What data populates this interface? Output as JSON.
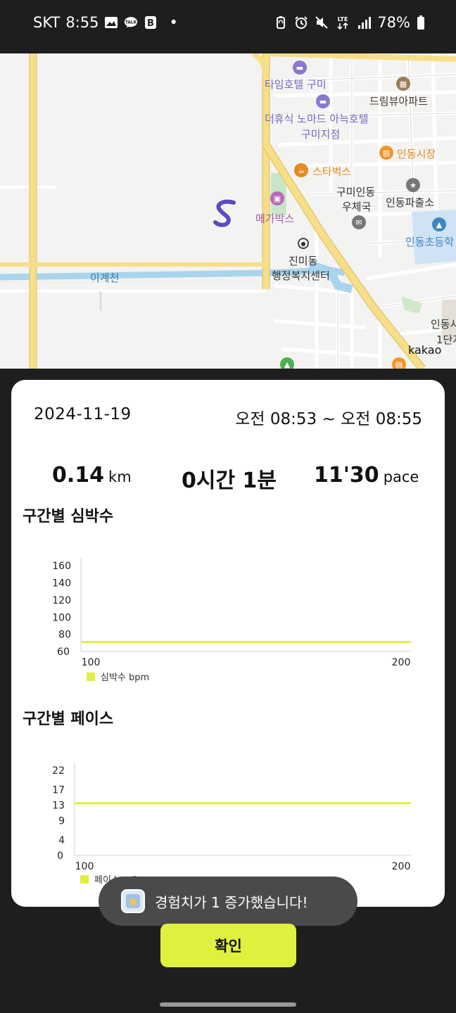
{
  "status_bar": {
    "carrier": "SKT",
    "time": "8:55",
    "dot": "•",
    "talk_badge": "TALK",
    "b_badge": "B",
    "network": "LTE",
    "battery": "78%"
  },
  "map": {
    "labels": {
      "time_hotel": "타임호텔 구미",
      "dream_view": "드림뷰아파트",
      "nomad_hotel_1": "더휴식 노마드 아늑호텔",
      "nomad_hotel_2": "구미지점",
      "indong_market": "인동시장",
      "starbucks": "스타벅스",
      "post_office_1": "구미인동",
      "post_office_2": "우체국",
      "police": "인동파출소",
      "megabox": "메가박스",
      "indong_school": "인동초등학",
      "jinmi_1": "진미동",
      "jinmi_2": "행정복지센터",
      "igyecheon": "이계천",
      "indong_bottom_1": "인동사",
      "indong_bottom_2": "1단지"
    },
    "kakao": "kakao"
  },
  "summary": {
    "date": "2024-11-19",
    "time_range": "오전 08:53 ~ 오전 08:55",
    "distance": "0.14",
    "distance_unit": "km",
    "duration": "0시간 1분",
    "pace": "11'30",
    "pace_unit": "pace"
  },
  "heart_section_title": "구간별 심박수",
  "pace_section_title": "구간별 페이스",
  "chart_data": [
    {
      "type": "line",
      "x": [
        100,
        200
      ],
      "series": [
        {
          "name": "심박수 bpm",
          "values": [
            71,
            71
          ]
        }
      ],
      "yticks": [
        "60",
        "80",
        "100",
        "120",
        "140",
        "160"
      ],
      "xticks": [
        "100",
        "200"
      ],
      "ylim": [
        60,
        170
      ],
      "xlim": [
        100,
        200
      ],
      "grid": false,
      "legend": "bottom-left",
      "color": "#e0f03e"
    },
    {
      "type": "line",
      "x": [
        100,
        200
      ],
      "series": [
        {
          "name": "페이스 m/h",
          "values": [
            13.5,
            13.5
          ]
        }
      ],
      "yticks": [
        "0",
        "4",
        "9",
        "13",
        "17",
        "22"
      ],
      "xticks": [
        "100",
        "200"
      ],
      "ylim": [
        0,
        24
      ],
      "xlim": [
        100,
        200
      ],
      "grid": false,
      "legend": "bottom-left",
      "color": "#e0f03e"
    }
  ],
  "toast": {
    "text": "경험치가 1 증가했습니다!"
  },
  "confirm_label": "확인"
}
